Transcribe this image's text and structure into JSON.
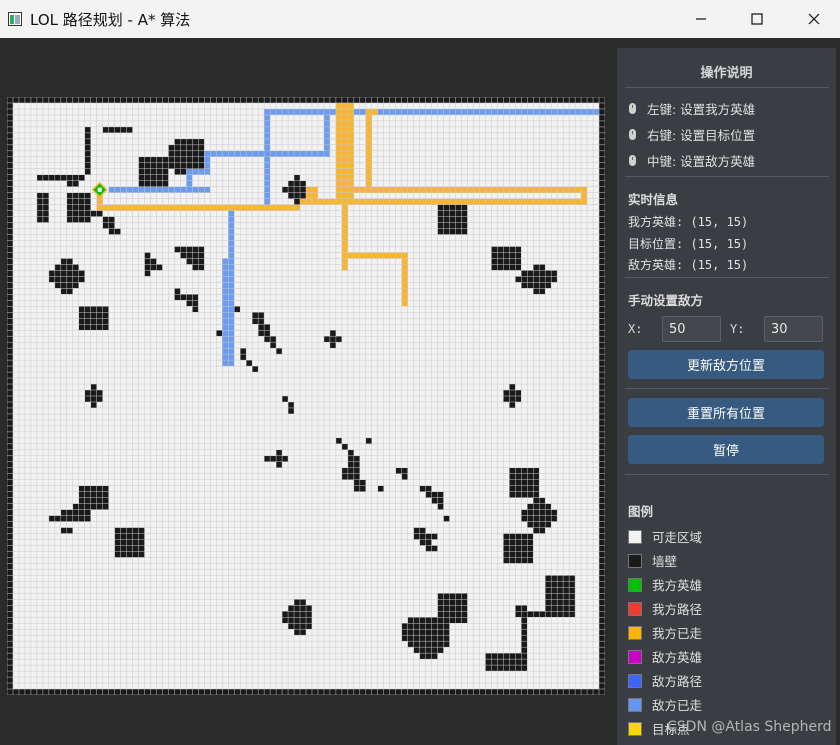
{
  "window": {
    "title": "LOL 路径规划 - A* 算法"
  },
  "panel": {
    "instructions_title": "操作说明",
    "instructions": [
      "左键: 设置我方英雄",
      "右键: 设置目标位置",
      "中键: 设置敌方英雄"
    ],
    "realtime_title": "实时信息",
    "realtime": [
      "我方英雄: (15, 15)",
      "目标位置: (15, 15)",
      "敌方英雄: (15, 15)"
    ],
    "manual_title": "手动设置敌方",
    "x_label": "X:",
    "x_value": "50",
    "y_label": "Y:",
    "y_value": "30",
    "update_button": "更新敌方位置",
    "reset_button": "重置所有位置",
    "pause_button": "暂停",
    "legend_title": "图例",
    "legend": [
      {
        "label": "可走区域",
        "color": "#f2f2f2"
      },
      {
        "label": "墙壁",
        "color": "#1a1a1a"
      },
      {
        "label": "我方英雄",
        "color": "#00c000"
      },
      {
        "label": "我方路径",
        "color": "#f03c32"
      },
      {
        "label": "我方已走",
        "color": "#ffb400"
      },
      {
        "label": "敌方英雄",
        "color": "#c800c8"
      },
      {
        "label": "敌方路径",
        "color": "#3c64ff"
      },
      {
        "label": "敌方已走",
        "color": "#6496f0"
      },
      {
        "label": "目标点",
        "color": "#ffd700"
      }
    ]
  },
  "watermark": "CSDN @Atlas Shepherd",
  "colors": {
    "walkable": "#f2f2f2",
    "grid_line": "#c8c8c8",
    "wall": "#1a1a1a",
    "own_walked": "#f8b530",
    "enemy_walked": "#6b9cf0",
    "own_hero": "#00c000",
    "accent_button": "#375a80"
  }
}
